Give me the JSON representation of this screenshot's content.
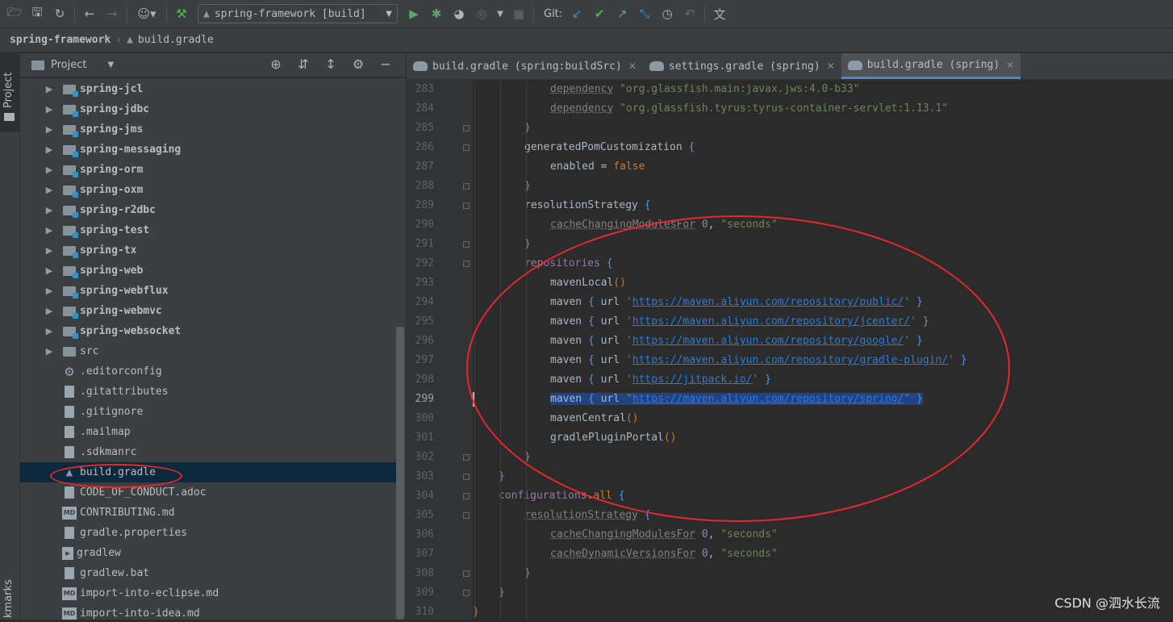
{
  "toolbar": {
    "run_config": "spring-framework [build]",
    "git_label": "Git:"
  },
  "breadcrumb": {
    "project": "spring-framework",
    "file": "build.gradle"
  },
  "side": {
    "project_tab": "Project",
    "bookmarks_tab": "kmarks"
  },
  "panel": {
    "title": "Project"
  },
  "tree": [
    {
      "label": "spring-jcl",
      "type": "module"
    },
    {
      "label": "spring-jdbc",
      "type": "module"
    },
    {
      "label": "spring-jms",
      "type": "module"
    },
    {
      "label": "spring-messaging",
      "type": "module"
    },
    {
      "label": "spring-orm",
      "type": "module"
    },
    {
      "label": "spring-oxm",
      "type": "module"
    },
    {
      "label": "spring-r2dbc",
      "type": "module"
    },
    {
      "label": "spring-test",
      "type": "module"
    },
    {
      "label": "spring-tx",
      "type": "module"
    },
    {
      "label": "spring-web",
      "type": "module"
    },
    {
      "label": "spring-webflux",
      "type": "module"
    },
    {
      "label": "spring-webmvc",
      "type": "module"
    },
    {
      "label": "spring-websocket",
      "type": "module"
    },
    {
      "label": "src",
      "type": "folder"
    },
    {
      "label": ".editorconfig",
      "type": "config"
    },
    {
      "label": ".gitattributes",
      "type": "file"
    },
    {
      "label": ".gitignore",
      "type": "file"
    },
    {
      "label": ".mailmap",
      "type": "file"
    },
    {
      "label": ".sdkmanrc",
      "type": "file"
    },
    {
      "label": "build.gradle",
      "type": "gradle",
      "selected": true
    },
    {
      "label": "CODE_OF_CONDUCT.adoc",
      "type": "file"
    },
    {
      "label": "CONTRIBUTING.md",
      "type": "md"
    },
    {
      "label": "gradle.properties",
      "type": "file"
    },
    {
      "label": "gradlew",
      "type": "exec"
    },
    {
      "label": "gradlew.bat",
      "type": "file"
    },
    {
      "label": "import-into-eclipse.md",
      "type": "md"
    },
    {
      "label": "import-into-idea.md",
      "type": "md"
    }
  ],
  "tabs": [
    {
      "label": "build.gradle (spring:buildSrc)",
      "active": false
    },
    {
      "label": "settings.gradle (spring)",
      "active": false
    },
    {
      "label": "build.gradle (spring)",
      "active": true
    }
  ],
  "code": [
    {
      "n": "283",
      "indent": 3,
      "parts": [
        [
          "d",
          "dependency"
        ],
        [
          "b",
          " "
        ],
        [
          "s",
          "\"org.glassfish.main:javax.jws:4.0-b33\""
        ]
      ]
    },
    {
      "n": "284",
      "indent": 3,
      "parts": [
        [
          "d",
          "dependency"
        ],
        [
          "b",
          " "
        ],
        [
          "s",
          "\"org.glassfish.tyrus:tyrus-container-servlet:1.13.1\""
        ]
      ]
    },
    {
      "n": "285",
      "indent": 2,
      "parts": [
        [
          "bl",
          "}"
        ]
      ]
    },
    {
      "n": "286",
      "indent": 2,
      "parts": [
        [
          "b",
          "generatedPomCustomization "
        ],
        [
          "bl",
          "{"
        ]
      ]
    },
    {
      "n": "287",
      "indent": 3,
      "parts": [
        [
          "b",
          "enabled = "
        ],
        [
          "k",
          "false"
        ]
      ]
    },
    {
      "n": "288",
      "indent": 2,
      "parts": [
        [
          "bl",
          "}"
        ]
      ]
    },
    {
      "n": "289",
      "indent": 2,
      "parts": [
        [
          "b",
          "resolutionStrategy "
        ],
        [
          "bl",
          "{"
        ]
      ]
    },
    {
      "n": "290",
      "indent": 3,
      "parts": [
        [
          "d",
          "cacheChangingModulesFor"
        ],
        [
          "b",
          " "
        ],
        [
          "n",
          "0"
        ],
        [
          "b",
          ", "
        ],
        [
          "s",
          "\"seconds\""
        ]
      ]
    },
    {
      "n": "291",
      "indent": 2,
      "parts": [
        [
          "bl",
          "}"
        ]
      ]
    },
    {
      "n": "292",
      "indent": 2,
      "parts": [
        [
          "p",
          "repositories"
        ],
        [
          "b",
          " "
        ],
        [
          "bl",
          "{"
        ]
      ]
    },
    {
      "n": "293",
      "indent": 3,
      "parts": [
        [
          "b",
          "mavenLocal"
        ],
        [
          "k",
          "()"
        ]
      ]
    },
    {
      "n": "294",
      "indent": 3,
      "parts": [
        [
          "b",
          "maven "
        ],
        [
          "bl",
          "{"
        ],
        [
          "b",
          " url "
        ],
        [
          "s",
          "'"
        ],
        [
          "u",
          "https://maven.aliyun.com/repository/public/"
        ],
        [
          "s",
          "'"
        ],
        [
          "b",
          " "
        ],
        [
          "bl",
          "}"
        ]
      ]
    },
    {
      "n": "295",
      "indent": 3,
      "parts": [
        [
          "b",
          "maven "
        ],
        [
          "bl",
          "{"
        ],
        [
          "b",
          " url "
        ],
        [
          "s",
          "'"
        ],
        [
          "u",
          "https://maven.aliyun.com/repository/jcenter/"
        ],
        [
          "s",
          "'"
        ],
        [
          "b",
          " "
        ],
        [
          "bl",
          "}"
        ]
      ]
    },
    {
      "n": "296",
      "indent": 3,
      "parts": [
        [
          "b",
          "maven "
        ],
        [
          "bl",
          "{"
        ],
        [
          "b",
          " url "
        ],
        [
          "s",
          "'"
        ],
        [
          "u",
          "https://maven.aliyun.com/repository/google/"
        ],
        [
          "s",
          "'"
        ],
        [
          "b",
          " "
        ],
        [
          "bl",
          "}"
        ]
      ]
    },
    {
      "n": "297",
      "indent": 3,
      "parts": [
        [
          "b",
          "maven "
        ],
        [
          "bl",
          "{"
        ],
        [
          "b",
          " url "
        ],
        [
          "s",
          "'"
        ],
        [
          "u",
          "https://maven.aliyun.com/repository/gradle-plugin/"
        ],
        [
          "s",
          "'"
        ],
        [
          "b",
          " "
        ],
        [
          "bl",
          "}"
        ]
      ]
    },
    {
      "n": "298",
      "indent": 3,
      "parts": [
        [
          "b",
          "maven "
        ],
        [
          "bl",
          "{"
        ],
        [
          "b",
          " url "
        ],
        [
          "s",
          "'"
        ],
        [
          "u",
          "https://jitpack.io/"
        ],
        [
          "s",
          "'"
        ],
        [
          "b",
          " "
        ],
        [
          "bl",
          "}"
        ]
      ]
    },
    {
      "n": "299",
      "indent": 3,
      "current": true,
      "parts": [
        [
          "b",
          "maven "
        ],
        [
          "bl",
          "{"
        ],
        [
          "b",
          " url "
        ],
        [
          "s",
          "\""
        ],
        [
          "u",
          "https://maven.aliyun.com/repository/spring/"
        ],
        [
          "s",
          "\""
        ],
        [
          "b",
          " "
        ],
        [
          "bl",
          "}"
        ]
      ]
    },
    {
      "n": "300",
      "indent": 3,
      "parts": [
        [
          "b",
          "mavenCentral"
        ],
        [
          "k",
          "()"
        ]
      ]
    },
    {
      "n": "301",
      "indent": 3,
      "parts": [
        [
          "b",
          "gradlePluginPortal"
        ],
        [
          "k",
          "()"
        ]
      ]
    },
    {
      "n": "302",
      "indent": 2,
      "parts": [
        [
          "bl",
          "}"
        ]
      ]
    },
    {
      "n": "303",
      "indent": 1,
      "parts": [
        [
          "bl",
          "}"
        ]
      ]
    },
    {
      "n": "304",
      "indent": 1,
      "parts": [
        [
          "p",
          "configurations"
        ],
        [
          "b",
          "."
        ],
        [
          "k",
          "all"
        ],
        [
          "b",
          " "
        ],
        [
          "bl",
          "{"
        ]
      ]
    },
    {
      "n": "305",
      "indent": 2,
      "parts": [
        [
          "d",
          "resolutionStrategy"
        ],
        [
          "b",
          " "
        ],
        [
          "bl",
          "{"
        ]
      ]
    },
    {
      "n": "306",
      "indent": 3,
      "parts": [
        [
          "d",
          "cacheChangingModulesFor"
        ],
        [
          "b",
          " "
        ],
        [
          "n",
          "0"
        ],
        [
          "b",
          ", "
        ],
        [
          "s",
          "\"seconds\""
        ]
      ]
    },
    {
      "n": "307",
      "indent": 3,
      "parts": [
        [
          "d",
          "cacheDynamicVersionsFor"
        ],
        [
          "b",
          " "
        ],
        [
          "n",
          "0"
        ],
        [
          "b",
          ", "
        ],
        [
          "s",
          "\"seconds\""
        ]
      ]
    },
    {
      "n": "308",
      "indent": 2,
      "parts": [
        [
          "bl",
          "}"
        ]
      ]
    },
    {
      "n": "309",
      "indent": 1,
      "parts": [
        [
          "bl",
          "}"
        ]
      ]
    },
    {
      "n": "310",
      "indent": 0,
      "parts": [
        [
          "k",
          "}"
        ]
      ]
    }
  ],
  "watermark": "CSDN @泗水长流",
  "colors": {
    "accent": "#4a88c7",
    "annotation": "#e8282d",
    "selection": "#214283"
  }
}
